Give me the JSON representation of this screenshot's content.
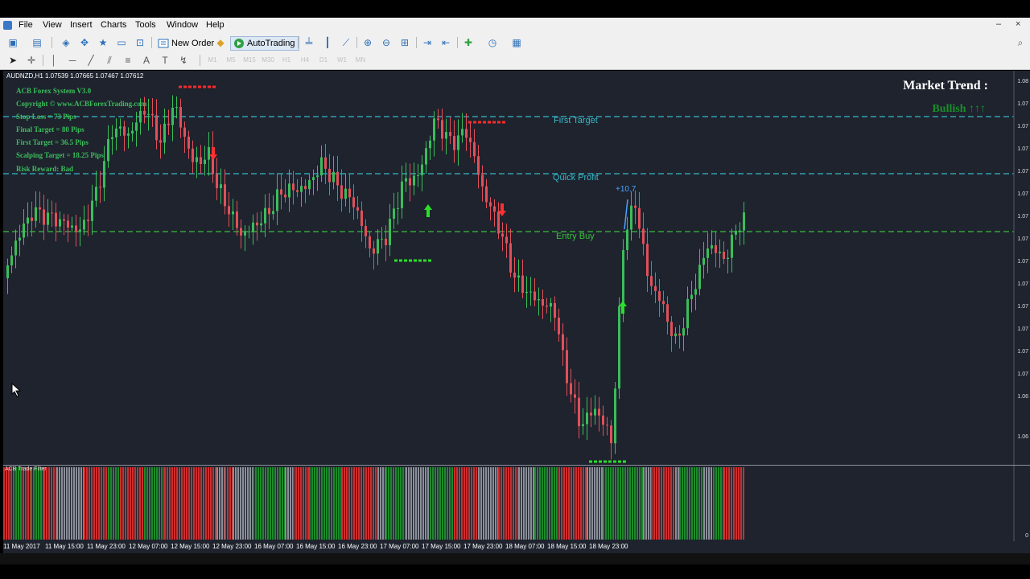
{
  "menu": {
    "items": [
      "File",
      "View",
      "Insert",
      "Charts",
      "Tools",
      "Window",
      "Help"
    ],
    "minimize": "–",
    "close": "×"
  },
  "toolbar": {
    "new_order": "New Order",
    "autotrading": "AutoTrading"
  },
  "chart": {
    "ohlc": "AUDNZD,H1  1.07539 1.07665 1.07467 1.07612",
    "info_panel": [
      "ACB Forex System V3.0",
      "Copyright © www.ACBForexTrading.com",
      "Stop Loss = 73 Pips",
      "Final Target = 80 Pips",
      "First Target = 36.5 Pips",
      "Scalping Target = 18.25 Pips",
      "Risk Reward: Bad"
    ],
    "market_trend_title": "Market Trend :",
    "market_trend_value": "Bullish ↑↑↑",
    "levels": {
      "first_target": "First Target",
      "quick_profit": "Quick Profit",
      "entry_buy": "Entry Buy"
    },
    "profit_label": "+10.7",
    "y_labels": [
      "1.08",
      "1.07",
      "1.07",
      "1.07",
      "1.07",
      "1.07",
      "1.07",
      "1.07",
      "1.07",
      "1.07",
      "1.07",
      "1.07",
      "1.07",
      "1.07",
      "1.06",
      "1.06"
    ]
  },
  "indicator": {
    "name": "ACB Trade Filter",
    "scale_zero": "0"
  },
  "x_labels": [
    "11 May 2017",
    "11 May 15:00",
    "11 May 23:00",
    "12 May 07:00",
    "12 May 15:00",
    "12 May 23:00",
    "16 May 07:00",
    "16 May 15:00",
    "16 May 23:00",
    "17 May 07:00",
    "17 May 15:00",
    "17 May 23:00",
    "18 May 07:00",
    "18 May 15:00",
    "18 May 23:00"
  ],
  "colors": {
    "chart_bg": "#1e232e",
    "bull": "#3bbd5a",
    "bear": "#e0505a",
    "level_cyan": "#37b8c8",
    "level_green": "#3cbf3c",
    "filter_red": "#cc2f2f",
    "filter_green": "#1e8a2c",
    "filter_gray": "#8a8f99"
  }
}
